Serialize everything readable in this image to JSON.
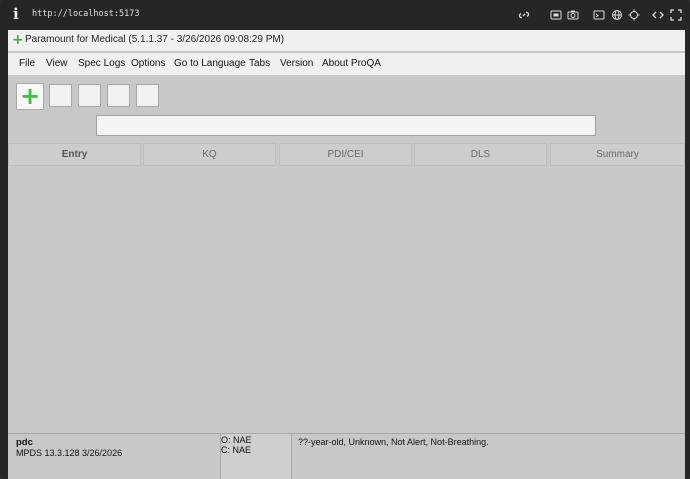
{
  "browser": {
    "url": "http://localhost:5173"
  },
  "window": {
    "title": "Paramount for Medical (5.1.1.37 - 3/26/2026 09:08:29 PM)",
    "title_icon": "plus-icon"
  },
  "menu": [
    "File",
    "View",
    "Spec Logs",
    "Options",
    "Go to Language",
    "Tabs",
    "Version",
    "About ProQA"
  ],
  "toolbar": {
    "add_button_icon": "plus-icon",
    "search_value": ""
  },
  "tabs": [
    "Entry",
    "KQ",
    "PDI/CEI",
    "DLS",
    "Summary"
  ],
  "status": {
    "user": "pdc",
    "version_line": "MPDS 13.3.128  3/26/2026",
    "origin": "O: NAE",
    "current": "C: NAE",
    "patient_summary": "??-year-old, Unknown, Not Alert, Not-Breathing."
  },
  "colors": {
    "accent_green": "#3fbf3f",
    "app_background": "#c8c8c8",
    "browser_chrome": "#262626"
  }
}
